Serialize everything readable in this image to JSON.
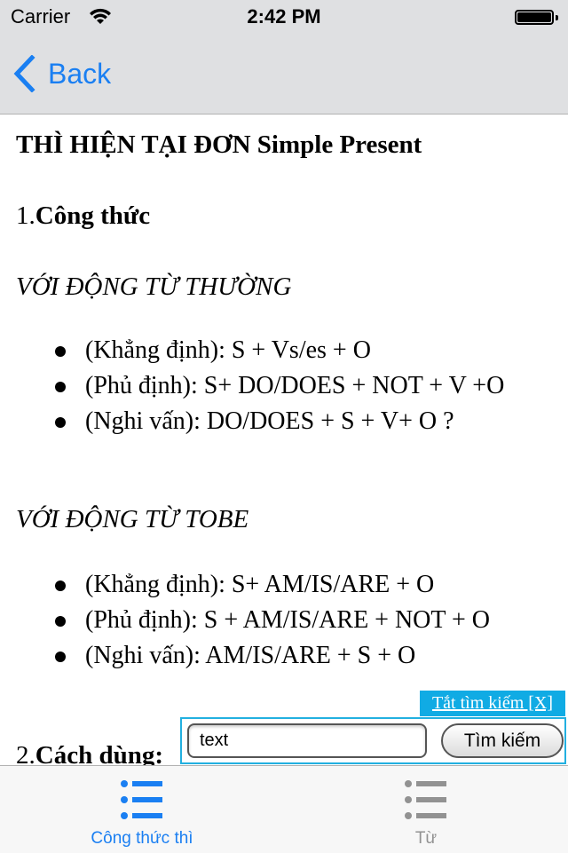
{
  "status_bar": {
    "carrier": "Carrier",
    "time": "2:42 PM",
    "wifi_icon": "wifi-icon",
    "battery_icon": "battery-full-icon"
  },
  "nav_bar": {
    "back_label": "Back",
    "back_icon": "chevron-left-icon"
  },
  "content": {
    "title": "THÌ HIỆN TẠI ĐƠN Simple Present",
    "section1_number": "1.",
    "section1_title": "Công thức",
    "subsection1": "VỚI ĐỘNG TỪ THƯỜNG",
    "list1": [
      "(Khẳng định): S + Vs/es + O",
      "(Phủ định): S+ DO/DOES + NOT + V +O",
      "(Nghi vấn): DO/DOES + S + V+ O ?"
    ],
    "subsection2": "VỚI ĐỘNG TỪ TOBE",
    "list2": [
      "(Khẳng định): S+ AM/IS/ARE + O",
      "(Phủ định): S + AM/IS/ARE + NOT + O",
      "(Nghi vấn): AM/IS/ARE + S + O"
    ],
    "section2_number": "2.",
    "section2_title": "Cách dùng:"
  },
  "search": {
    "close_label": "Tắt tìm kiếm [X]",
    "input_value": "text",
    "button_label": "Tìm kiếm"
  },
  "tab_bar": {
    "tabs": [
      {
        "label": "Công thức thì",
        "icon": "list-icon",
        "active": true
      },
      {
        "label": "Từ",
        "icon": "list-icon",
        "active": false
      }
    ]
  },
  "colors": {
    "accent": "#1a7ff2",
    "inactive": "#929292",
    "search_highlight": "#10abe4",
    "bar_background": "#dfe0e2"
  }
}
